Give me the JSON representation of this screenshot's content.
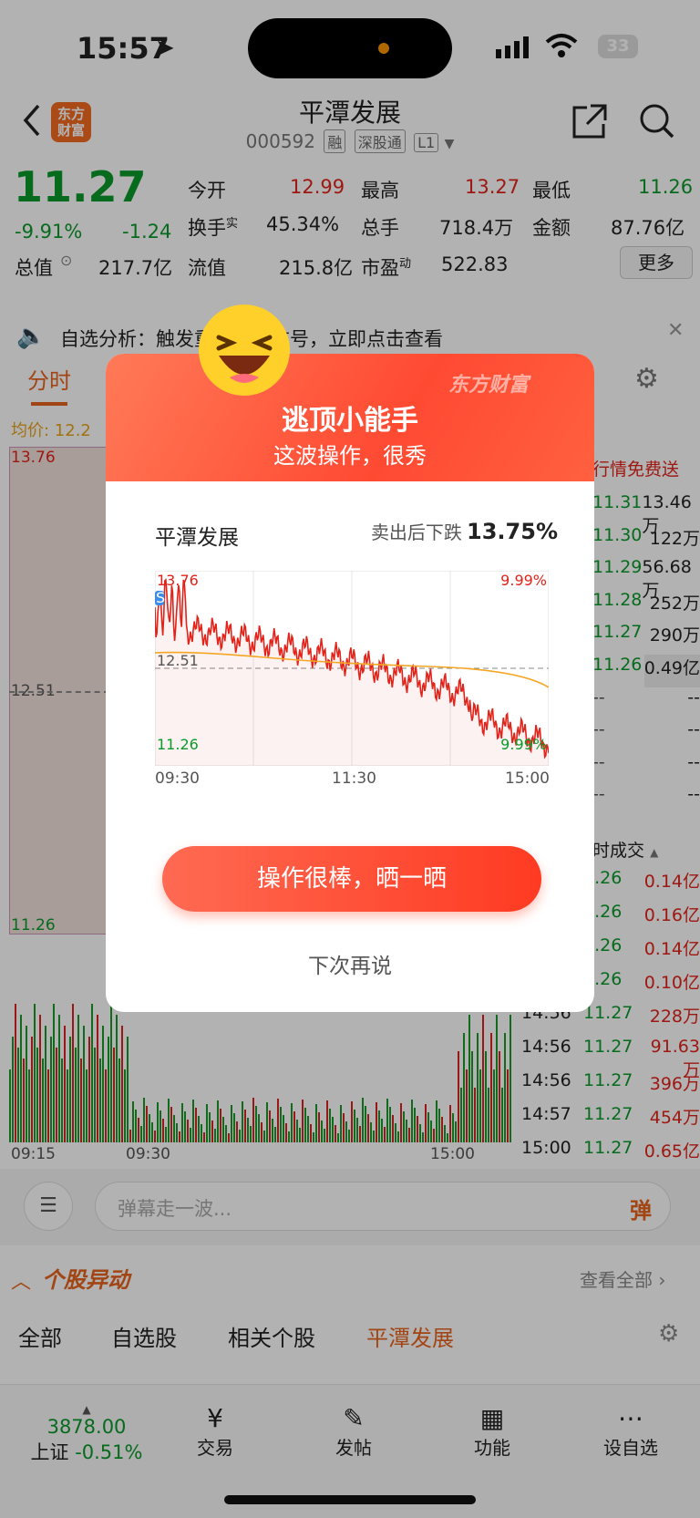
{
  "status_bar": {
    "time": "15:57",
    "battery": "33"
  },
  "header": {
    "logo_text": "东方财富",
    "stock_name": "平潭发展",
    "stock_code": "000592",
    "tags": [
      "融",
      "深股通",
      "L1"
    ]
  },
  "quote": {
    "price": "11.27",
    "change_pct": "-9.91%",
    "change": "-1.24",
    "open_label": "今开",
    "open": "12.99",
    "high_label": "最高",
    "high": "13.27",
    "low_label": "最低",
    "low": "11.26",
    "turnover_label": "换手",
    "turnover_sup": "实",
    "turnover": "45.34%",
    "volume_label": "总手",
    "volume": "718.4万",
    "amount_label": "金额",
    "amount": "87.76亿",
    "mktcap_label": "总值",
    "mktcap": "217.7亿",
    "float_label": "流值",
    "float": "215.8亿",
    "pe_label": "市盈",
    "pe_sup": "动",
    "pe": "522.83",
    "more": "更多"
  },
  "notice": {
    "text": "自选分析：触发重点关注信号，立即点击查看"
  },
  "tabs": {
    "active": "分时"
  },
  "intraday": {
    "avg_label": "均价: 12.2",
    "high_axis": "13.76",
    "mid_axis": "12.51",
    "low_axis": "11.26",
    "x_labels": [
      "09:15",
      "09:30",
      "15:00"
    ],
    "promo": "行情免费送"
  },
  "order_book": [
    {
      "price": "11.31",
      "vol": "13.46万"
    },
    {
      "price": "11.30",
      "vol": "122万"
    },
    {
      "price": "11.29",
      "vol": "56.68万"
    },
    {
      "price": "11.28",
      "vol": "252万"
    },
    {
      "price": "11.27",
      "vol": "290万"
    },
    {
      "price": "11.26",
      "vol": "0.49亿"
    },
    {
      "price": "--",
      "vol": "--"
    },
    {
      "price": "--",
      "vol": "--"
    },
    {
      "price": "--",
      "vol": "--"
    },
    {
      "price": "--",
      "vol": "--"
    }
  ],
  "ticks_header": "时成交",
  "ticks": [
    {
      "time": "",
      "price": "1.26",
      "amt": "0.14亿"
    },
    {
      "time": "",
      "price": "1.26",
      "amt": "0.16亿"
    },
    {
      "time": "",
      "price": "1.26",
      "amt": "0.14亿"
    },
    {
      "time": "",
      "price": "1.26",
      "amt": "0.10亿"
    },
    {
      "time": "14:56",
      "price": "11.27",
      "amt": "228万"
    },
    {
      "time": "14:56",
      "price": "11.27",
      "amt": "91.63万"
    },
    {
      "time": "14:56",
      "price": "11.27",
      "amt": "396万"
    },
    {
      "time": "14:57",
      "price": "11.27",
      "amt": "454万"
    },
    {
      "time": "15:00",
      "price": "11.27",
      "amt": "0.65亿"
    }
  ],
  "comment": {
    "placeholder": "弹幕走一波...",
    "send_icon_label": "弹"
  },
  "movers": {
    "title": "个股异动",
    "view_all": "查看全部",
    "tabs": [
      "全部",
      "自选股",
      "相关个股",
      "平潭发展"
    ]
  },
  "bottom_nav": {
    "index_value": "3878.00",
    "index_name": "上证",
    "index_change": "-0.51%",
    "items": [
      "交易",
      "发帖",
      "功能",
      "设自选"
    ]
  },
  "modal": {
    "brand": "东方财富",
    "title": "逃顶小能手",
    "subtitle": "这波操作，很秀",
    "stock_name": "平潭发展",
    "drop_label": "卖出后下跌",
    "drop_value": "13.75%",
    "chart_high": "13.76",
    "chart_high_pct": "9.99%",
    "chart_mid": "12.51",
    "chart_low": "11.26",
    "chart_low_pct": "9.99%",
    "chart_times": [
      "09:30",
      "11:30",
      "15:00"
    ],
    "sell_marker": "S",
    "cta": "操作很棒，晒一晒",
    "dismiss": "下次再说",
    "colors": {
      "price_line": "#e2231a",
      "avg_line": "#f5a623"
    }
  }
}
